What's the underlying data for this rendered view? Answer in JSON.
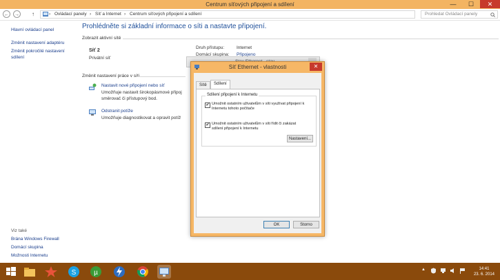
{
  "window": {
    "title": "Centrum síťových připojení a sdílení",
    "minimize": "—",
    "maximize": "☐",
    "close": "✕"
  },
  "nav": {
    "back": "←",
    "forward": "→",
    "up": "↑",
    "breadcrumbs": [
      "Ovládací panely",
      "Síť a Internet",
      "Centrum síťových připojení a sdílení"
    ],
    "sep": "›",
    "search_placeholder": "Prohledat Ovládací panely"
  },
  "sidebar": {
    "items": [
      "Hlavní ovládací panel",
      "Změnit nastavení adaptéru",
      "Změnit pokročilé nastavení",
      "sdílení"
    ],
    "see_also": "Viz také",
    "see_also_items": [
      "Brána Windows Firewall",
      "Domácí skupina",
      "Možnosti Internetu"
    ]
  },
  "main": {
    "heading": "Prohlédněte si základní informace o síti a nastavte připojení.",
    "active_section": "Zobrazit aktivní sítě",
    "network_name": "Síť 2",
    "network_type": "Privátní síť",
    "access_type_label": "Druh přístupu:",
    "access_type_value": "Internet",
    "homegroup_label": "Domácí skupina:",
    "homegroup_value": "Připojeno",
    "change_section": "Změnit nastavení práce v síti",
    "task1_link": "Nastavit nové připojení nebo síť",
    "task1_desc1": "Umožňuje nastavit širokopásmové připoj",
    "task1_desc2": "směrovač či přístupový bod.",
    "task2_link": "Odstranit potíže",
    "task2_desc": "Umožňuje diagnostikovat a opravit potíž"
  },
  "bg_dialog": {
    "title_fragment": "Stav Ethernet - stav"
  },
  "dialog": {
    "title": "Síť Ethernet - vlastnosti",
    "close": "✕",
    "tabs": [
      "Sítě",
      "Sdílení"
    ],
    "group_title": "Sdílení připojení k Internetu",
    "cb1_line1": "Umožnit ostatním uživatelům v síti využívat připojení k",
    "cb1_line2": "Internetu tohoto počítače",
    "cb2_line1": "Umožnit ostatním uživatelům v síti řídit či zakázat",
    "cb2_line2": "sdílení připojení k Internetu",
    "check_mark": "✔",
    "settings_button": "Nastavení...",
    "ok": "OK",
    "cancel": "Storno"
  },
  "taskbar": {
    "time": "14:41",
    "date": "23. 6. 2014",
    "tray_arrow": "▲"
  },
  "colors": {
    "titlebar": "#f3b462",
    "taskbar": "#8a4a0c",
    "link": "#1a3e8c",
    "heading": "#1e4f9a",
    "close": "#c7392c"
  }
}
